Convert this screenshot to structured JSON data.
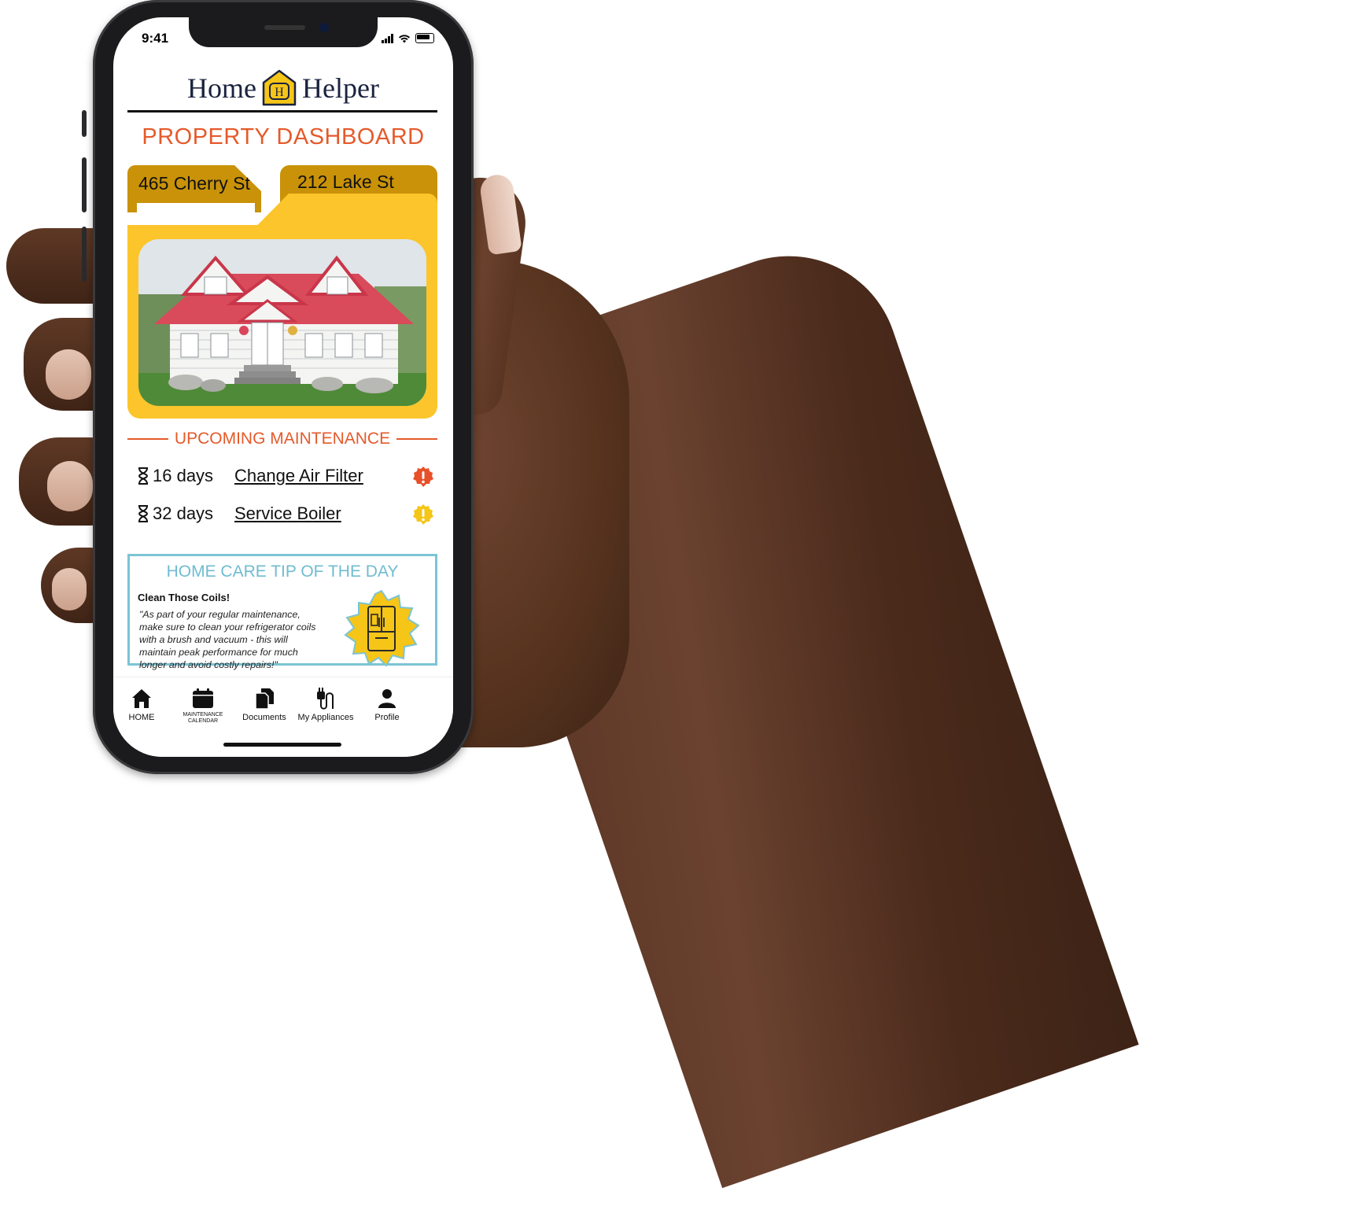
{
  "status_bar": {
    "time": "9:41"
  },
  "app": {
    "logo_left": "Home",
    "logo_badge": "H",
    "logo_right": "Helper",
    "page_title": "PROPERTY DASHBOARD"
  },
  "properties": {
    "tabs": [
      {
        "label": "465 Cherry St",
        "active": true
      },
      {
        "label": "212 Lake St",
        "active": false
      }
    ],
    "photo": "house-photo"
  },
  "maintenance": {
    "heading": "UPCOMING MAINTENANCE",
    "tasks": [
      {
        "days": "16 days",
        "task": "Change Air Filter",
        "alert_color": "#e8502a",
        "alert_mark": "!"
      },
      {
        "days": "32 days",
        "task": "Service Boiler",
        "alert_color": "#f5c518",
        "alert_mark": "!"
      }
    ]
  },
  "tip": {
    "heading": "HOME CARE TIP OF THE DAY",
    "subtitle": "Clean Those Coils!",
    "body": "\"As part of your regular maintenance, make sure to clean your refrigerator coils with a brush and vacuum - this will maintain peak performance for much longer and avoid costly repairs!\"",
    "icon": "refrigerator-icon"
  },
  "nav": {
    "items": [
      {
        "label": "HOME",
        "icon": "home-icon"
      },
      {
        "label": "MAINTENANCE CALENDAR",
        "icon": "calendar-icon"
      },
      {
        "label": "Documents",
        "icon": "documents-icon"
      },
      {
        "label": "My Appliances",
        "icon": "appliance-plug-icon"
      },
      {
        "label": "Profile",
        "icon": "profile-icon"
      }
    ]
  },
  "colors": {
    "accent_orange": "#e55a2b",
    "folder_yellow": "#fbc52b",
    "folder_tab": "#c99208",
    "tip_blue": "#7cc4d4",
    "navy": "#1b2340"
  }
}
